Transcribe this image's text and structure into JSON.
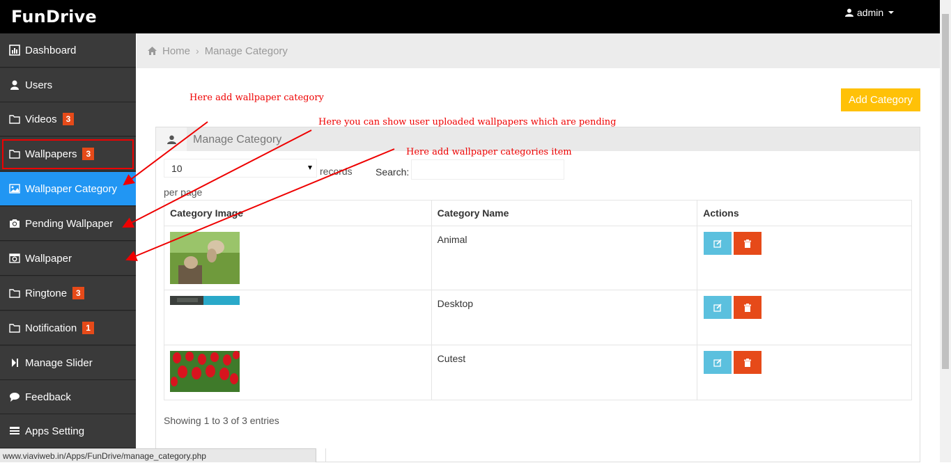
{
  "app": {
    "brand": "FunDrive",
    "user": "admin"
  },
  "sidebar": {
    "items": [
      {
        "label": "Dashboard",
        "icon": "bar-chart-icon"
      },
      {
        "label": "Users",
        "icon": "user-icon"
      },
      {
        "label": "Videos",
        "icon": "folder-icon",
        "badge": "3"
      },
      {
        "label": "Wallpapers",
        "icon": "folder-icon",
        "badge": "3"
      },
      {
        "label": "Wallpaper Category",
        "icon": "image-icon"
      },
      {
        "label": "Pending Wallpaper",
        "icon": "camera-icon"
      },
      {
        "label": "Wallpaper",
        "icon": "photo-camera-icon"
      },
      {
        "label": "Ringtone",
        "icon": "folder-icon",
        "badge": "3"
      },
      {
        "label": "Notification",
        "icon": "folder-icon",
        "badge": "1"
      },
      {
        "label": "Manage Slider",
        "icon": "step-forward-icon"
      },
      {
        "label": "Feedback",
        "icon": "comment-icon"
      },
      {
        "label": "Apps Setting",
        "icon": "settings-list-icon"
      }
    ]
  },
  "breadcrumb": {
    "home": "Home",
    "current": "Manage Category"
  },
  "toolbar": {
    "add_label": "Add Category"
  },
  "panel": {
    "title": "Manage Category"
  },
  "table_controls": {
    "length_value": "10",
    "records_label": "records",
    "per_page_label": "per page",
    "search_label": "Search:"
  },
  "table": {
    "headers": [
      "Category Image",
      "Category Name",
      "Actions"
    ],
    "rows": [
      {
        "name": "Animal"
      },
      {
        "name": "Desktop"
      },
      {
        "name": "Cutest"
      }
    ]
  },
  "info": "Showing 1 to 3 of 3 entries",
  "status_url": "www.viaviweb.in/Apps/FunDrive/manage_category.php",
  "annotations": [
    "Here add wallpaper category",
    "Here you can show user uploaded wallpapers which are pending",
    "Here add wallpaper categories item"
  ],
  "colors": {
    "accent_active": "#2196f3",
    "add_button": "#ffc107",
    "edit_button": "#5bc0de",
    "delete_button": "#e64a19",
    "annotation": "#ee0000"
  }
}
